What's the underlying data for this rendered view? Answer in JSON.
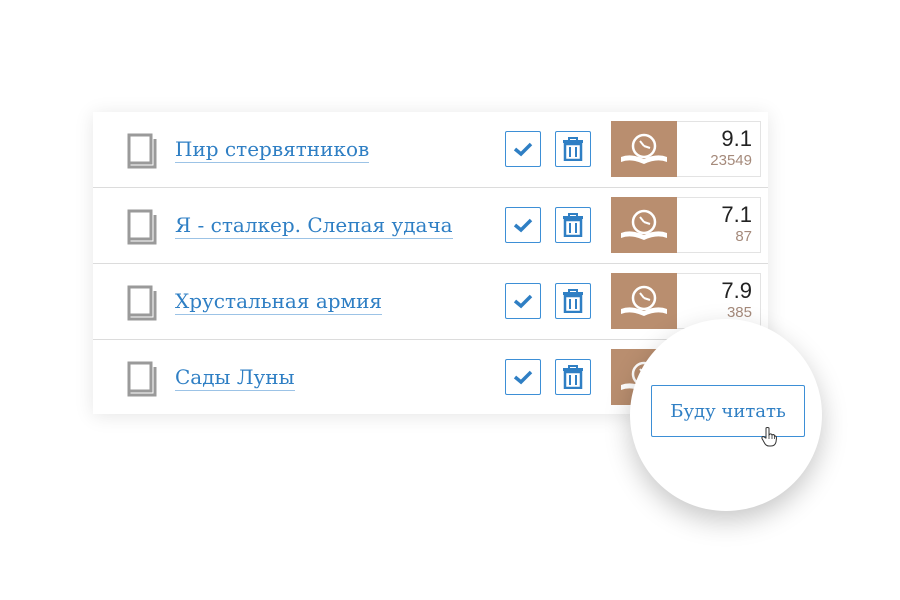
{
  "books": [
    {
      "title": "Пир стервятников",
      "rating": "9.1",
      "votes": "23549"
    },
    {
      "title": "Я - сталкер. Слепая удача",
      "rating": "7.1",
      "votes": "87"
    },
    {
      "title": "Хрустальная армия",
      "rating": "7.9",
      "votes": "385"
    },
    {
      "title": "Сады Луны",
      "rating": "",
      "votes": ""
    }
  ],
  "popup": {
    "read_label": "Буду читать"
  },
  "icons": {
    "book": "book-icon",
    "check": "check-icon",
    "trash": "trash-icon",
    "rating_logo": "open-book-clock-icon",
    "cursor": "hand-cursor-icon"
  },
  "colors": {
    "accent": "#2f7fc4",
    "rating_bg": "#b98e6f",
    "icon_gray": "#9a9a9a"
  }
}
